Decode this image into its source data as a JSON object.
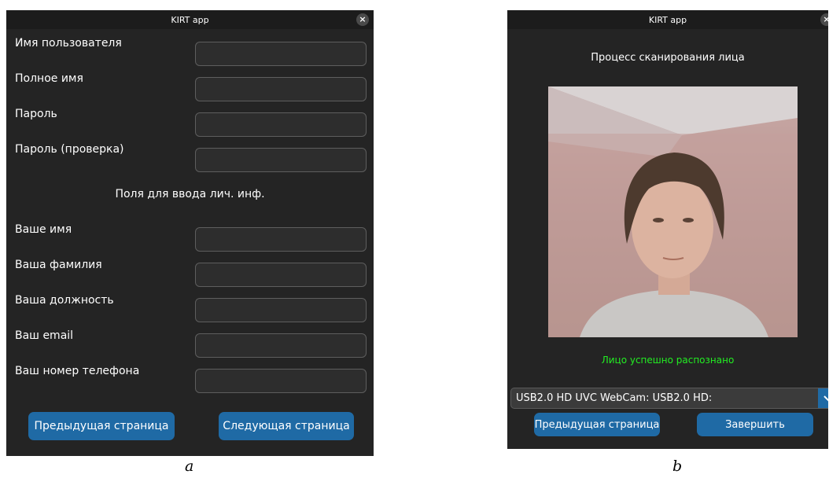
{
  "panel_a": {
    "window_title": "KIRT app",
    "close_glyph": "×",
    "account_fields": [
      {
        "label": "Имя пользователя",
        "value": ""
      },
      {
        "label": "Полное имя",
        "value": ""
      },
      {
        "label": "Пароль",
        "value": ""
      },
      {
        "label": "Пароль (проверка)",
        "value": ""
      }
    ],
    "personal_heading": "Поля для ввода лич. инф.",
    "personal_fields": [
      {
        "label": "Ваше имя",
        "value": ""
      },
      {
        "label": "Ваша фамилия",
        "value": ""
      },
      {
        "label": "Ваша должность",
        "value": ""
      },
      {
        "label": "Ваш email",
        "value": ""
      },
      {
        "label": "Ваш номер телефона",
        "value": ""
      }
    ],
    "prev_button": "Предыдущая страница",
    "next_button": "Следующая страница"
  },
  "panel_b": {
    "window_title": "KIRT app",
    "close_glyph": "×",
    "heading": "Процесс сканирования лица",
    "status": "Лицо успешно распознано",
    "status_color": "#22ee22",
    "camera_select_value": "USB2.0 HD UVC WebCam: USB2.0 HD:",
    "prev_button": "Предыдущая страница",
    "finish_button": "Завершить"
  },
  "captions": {
    "a": "a",
    "b": "b"
  },
  "colors": {
    "window_bg": "#242424",
    "titlebar_bg": "#1c1c1c",
    "input_bg": "#2d2d2d",
    "input_border": "#5e5e5e",
    "button_bg": "#1f6aa5"
  },
  "icons": {
    "close": "close-icon",
    "dropdown": "chevron-down-icon"
  }
}
